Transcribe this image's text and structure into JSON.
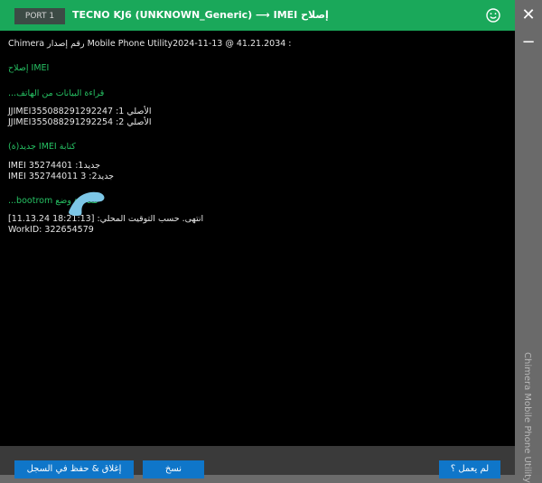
{
  "titlebar": {
    "port": "PORT 1",
    "title": "TECNO KJ6 (UNKNOWN_Generic) ⟶ IMEI إصلاح",
    "smile_icon": "smile-icon"
  },
  "window_controls": {
    "close": "✕",
    "minimize": "−"
  },
  "sidebar_vertical_text": "Chimera Mobile Phone Utility",
  "console": {
    "lines": [
      {
        "text": "Chimera رقم إصدار Mobile Phone Utility2024-11-13 @ 41.21.2034 :",
        "green": false
      },
      {
        "text": "إصلاح IMEI",
        "green": true
      },
      {
        "text": "...قراءة البيانات من الهاتف",
        "green": true
      },
      {
        "text": "JJIMEI355088291292247 :الأصلي 1",
        "green": false
      },
      {
        "text": "JJIMEI355088291292254 :الأصلي 2",
        "green": false
      },
      {
        "text": "جديد(ة) IMEI كتابة",
        "green": true
      },
      {
        "text": "IMEI 35274401 :جديد1",
        "green": false
      },
      {
        "text": "IMEI 352744011          3 :جديد2",
        "green": false
      },
      {
        "text": "...bootrom مغادرة وضع",
        "green": true
      },
      {
        "text": "انتهى. حسب التوقيت المحلي: [18:21:13 11.13.24]",
        "green": false
      },
      {
        "text": "WorkID: 322654579",
        "green": false
      }
    ]
  },
  "buttons": {
    "close_save": "إغلاق & حفظ في السجل",
    "copy": "نسخ",
    "help": "لم يعمل ؟"
  }
}
